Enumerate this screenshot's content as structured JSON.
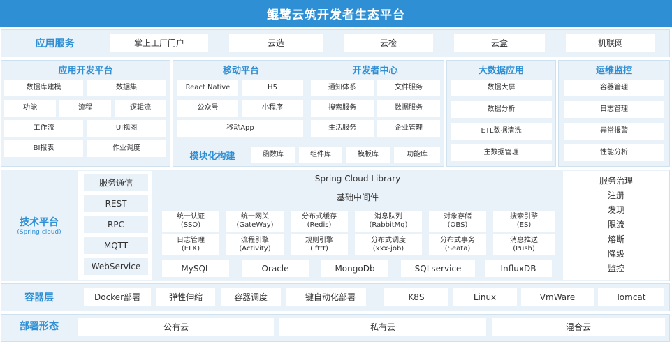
{
  "title": "鲲鹭云筑开发者生态平台",
  "app_services": {
    "label": "应用服务",
    "items": [
      "掌上工厂门户",
      "云造",
      "云检",
      "云盒",
      "机联网"
    ]
  },
  "dev_platform": {
    "title": "应用开发平台",
    "items": [
      "数据库建模",
      "数据集",
      "功能",
      "流程",
      "逻辑流",
      "工作流",
      "UI视图",
      "BI报表",
      "作业调度"
    ]
  },
  "mobile_platform": {
    "title": "移动平台",
    "items": [
      "React Native",
      "H5",
      "公众号",
      "小程序",
      "移动App"
    ]
  },
  "dev_center": {
    "title": "开发者中心",
    "items": [
      "通知体系",
      "文件服务",
      "搜索服务",
      "数据服务",
      "生活服务",
      "企业管理"
    ]
  },
  "modular": {
    "title": "模块化构建",
    "items": [
      "函数库",
      "组件库",
      "模板库",
      "功能库"
    ]
  },
  "bigdata": {
    "title": "大数据应用",
    "items": [
      "数据大屏",
      "数据分析",
      "ETL数据清洗",
      "主数据管理"
    ]
  },
  "ops": {
    "title": "运维监控",
    "items": [
      "容器管理",
      "日志管理",
      "异常报警",
      "性能分析"
    ]
  },
  "tech_platform": {
    "label": "技术平台",
    "sub": "(Spring cloud)",
    "comm": [
      "服务通信",
      "REST",
      "RPC",
      "MQTT",
      "WebService"
    ],
    "library": "Spring Cloud Library",
    "middleware": "基础中间件",
    "mw_row1": [
      {
        "name": "统一认证",
        "sub": "(SSO)"
      },
      {
        "name": "统一网关",
        "sub": "(GateWay)"
      },
      {
        "name": "分布式缓存",
        "sub": "(Redis)"
      },
      {
        "name": "消息队列",
        "sub": "(RabbitMq)"
      },
      {
        "name": "对象存储",
        "sub": "(OBS)"
      },
      {
        "name": "搜索引擎",
        "sub": "(ES)"
      }
    ],
    "mw_row2": [
      {
        "name": "日志管理",
        "sub": "(ELK)"
      },
      {
        "name": "流程引擎",
        "sub": "(Activity)"
      },
      {
        "name": "规则引擎",
        "sub": "(Ifttt)"
      },
      {
        "name": "分布式调度",
        "sub": "(xxx-job)"
      },
      {
        "name": "分布式事务",
        "sub": "(Seata)"
      },
      {
        "name": "消息推送",
        "sub": "(Push)"
      }
    ],
    "databases": [
      "MySQL",
      "Oracle",
      "MongoDb",
      "SQLservice",
      "InfluxDB"
    ],
    "governance": [
      "服务治理",
      "注册",
      "发现",
      "限流",
      "熔断",
      "降级",
      "监控"
    ]
  },
  "container": {
    "label": "容器层",
    "left": [
      "Docker部署",
      "弹性伸缩",
      "容器调度",
      "一键自动化部署"
    ],
    "right": [
      "K8S",
      "Linux",
      "VmWare",
      "Tomcat"
    ]
  },
  "deploy": {
    "label": "部署形态",
    "items": [
      "公有云",
      "私有云",
      "混合云"
    ]
  }
}
